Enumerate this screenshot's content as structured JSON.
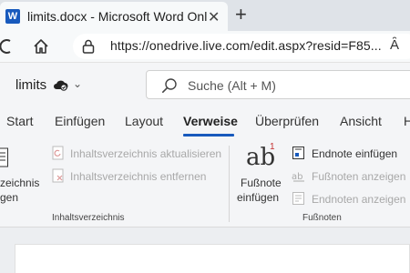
{
  "browser": {
    "tab_title": "limits.docx - Microsoft Word Onl",
    "tab_icon_letter": "W",
    "url": "https://onedrive.live.com/edit.aspx?resid=F85...",
    "read_aloud_glyph": "Ȃ"
  },
  "word": {
    "doc_name": "limits",
    "search_placeholder": "Suche (Alt + M)"
  },
  "ribbon_tabs": [
    "Start",
    "Einfügen",
    "Layout",
    "Verweise",
    "Überprüfen",
    "Ansicht",
    "H"
  ],
  "active_tab": "Verweise",
  "ribbon": {
    "toc_label_line1": "zeichnis",
    "toc_label_line2": "gen",
    "toc_update": "Inhaltsverzeichnis aktualisieren",
    "toc_remove": "Inhaltsverzeichnis entfernen",
    "toc_group": "Inhaltsverzeichnis",
    "footnote_line1": "Fußnote",
    "footnote_line2": "einfügen",
    "footnote_icon_text": "ab",
    "footnote_sup": "1",
    "endnote_insert": "Endnote einfügen",
    "footnotes_show": "Fußnoten anzeigen",
    "endnotes_show": "Endnoten anzeigen",
    "footnote_group": "Fußnoten"
  },
  "colors": {
    "accent": "#185abd",
    "disabled_text": "#a8a8a8"
  }
}
